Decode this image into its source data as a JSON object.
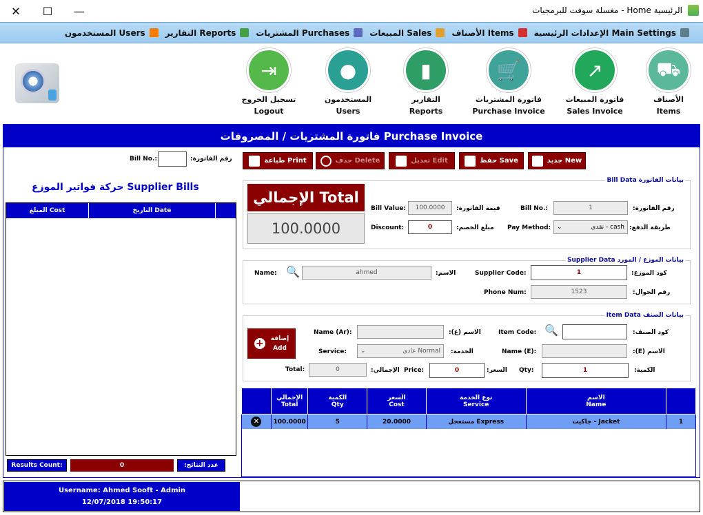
{
  "window": {
    "title": "الرئيسية Home - مغسلة سوفت للبرمجيات",
    "minimize": "—",
    "maximize": "☐",
    "close": "✕"
  },
  "menu": [
    {
      "label": "الإعدادات الرئيسية Main Settings",
      "icon": "gear-icon",
      "color": "#607d8b"
    },
    {
      "label": "الأصناف Items",
      "icon": "cart-icon",
      "color": "#d32f2f"
    },
    {
      "label": "المبيعات Sales",
      "icon": "box-icon",
      "color": "#e0a030"
    },
    {
      "label": "المشتريات Purchases",
      "icon": "box-tag-icon",
      "color": "#5c6bc0"
    },
    {
      "label": "التقارير Reports",
      "icon": "chart-icon",
      "color": "#43a047"
    },
    {
      "label": "المستخدمون Users",
      "icon": "users-icon",
      "color": "#f57c00"
    }
  ],
  "toolbar": [
    {
      "ar": "الأصناف",
      "en": "Items",
      "icon": "trolley-icon",
      "color": "#5cb89a"
    },
    {
      "ar": "فاتورة المبيعات",
      "en": "Sales Invoice",
      "icon": "growth-chart-icon",
      "color": "#22a85a"
    },
    {
      "ar": "فاتورة المشتريات",
      "en": "Purchase Invoice",
      "icon": "shopping-cart-icon",
      "color": "#3fa39a"
    },
    {
      "ar": "التقارير",
      "en": "Reports",
      "icon": "bar-chart-icon",
      "color": "#2e9e66"
    },
    {
      "ar": "المستخدمون",
      "en": "Users",
      "icon": "user-icon",
      "color": "#2aa095"
    },
    {
      "ar": "تسجيل الخروج",
      "en": "Logout",
      "icon": "logout-icon",
      "color": "#55b84a"
    }
  ],
  "panel": {
    "title": "فاتورة المشتريات / المصروفات Purchase Invoice"
  },
  "buttons": {
    "new": "جديد New",
    "save": "حفظ Save",
    "edit": "تعديل Edit",
    "delete": "حذف Delete",
    "print": "طباعة Print"
  },
  "bill_no": {
    "label_ar": "رقم الفاتورة:",
    "label_en": "Bill No.:",
    "value": ""
  },
  "bill_data": {
    "group": "بيانات الفاتورة Bill Data",
    "bill_no_ar": "رقم الفاتورة:",
    "bill_no_en": "Bill No.:",
    "bill_no": "1",
    "bill_value_ar": "قيمة الفاتورة:",
    "bill_value_en": "Bill Value:",
    "bill_value": "100.0000",
    "pay_method_ar": "طريقة الدفع:",
    "pay_method_en": "Pay Method:",
    "pay_method": "نقدي - cash",
    "discount_ar": "مبلغ الخصم:",
    "discount_en": "Discount:",
    "discount": "0",
    "total_title": "الإجمالي Total",
    "total_value": "100.0000"
  },
  "supplier": {
    "group": "بيانات الموزع / المورد Supplier Data",
    "code_ar": "كود الموزع:",
    "code_en": "Supplier Code:",
    "code": "1",
    "name_ar": "الاسم:",
    "name_en": "Name:",
    "name": "ahmed",
    "phone_ar": "رقم الجوال:",
    "phone_en": "Phone Num:",
    "phone": "1523"
  },
  "item": {
    "group": "بيانات الصنف Item Data",
    "code_ar": "كود الصنف:",
    "code_en": "Item Code:",
    "code": "",
    "name_ar_label": "الاسم (ع):",
    "name_ar_en": "Name (Ar):",
    "name_ar": "",
    "name_e_label": "الاسم (E):",
    "name_e_en": "Name (E):",
    "name_e": "",
    "service_ar": "الخدمة:",
    "service_en": "Service:",
    "service": "عادي Normal",
    "qty_ar": "الكمية:",
    "qty_en": "Qty:",
    "qty": "1",
    "price_ar": "السعر:",
    "price_en": "Price:",
    "price": "0",
    "total_ar": "الإجمالي:",
    "total_en": "Total:",
    "total": "0",
    "add_ar": "إضافة",
    "add_en": "Add"
  },
  "items_table": {
    "headers": [
      {
        "ar": "",
        "en": ""
      },
      {
        "ar": "الاسم",
        "en": "Name"
      },
      {
        "ar": "نوع الخدمة",
        "en": "Service"
      },
      {
        "ar": "السعر",
        "en": "Cost"
      },
      {
        "ar": "الكمية",
        "en": "Qty"
      },
      {
        "ar": "الإجمالي",
        "en": "Total"
      },
      {
        "ar": "",
        "en": ""
      }
    ],
    "rows": [
      {
        "no": "1",
        "name": "جاكيت - Jacket",
        "service": "مستعجل Express",
        "cost": "20.0000",
        "qty": "5",
        "total": "100.0000"
      }
    ]
  },
  "supplier_bills": {
    "title": "حركة فواتير الموزع Supplier Bills",
    "col_date": "التاريخ Date",
    "col_cost": "المبلغ Cost",
    "results_en": "Results Count:",
    "results_ar": "عدد النتائج:",
    "results": "0"
  },
  "status": {
    "username": "Username: Ahmed Sooft - Admin",
    "datetime": "12/07/2018 19:50:17"
  }
}
